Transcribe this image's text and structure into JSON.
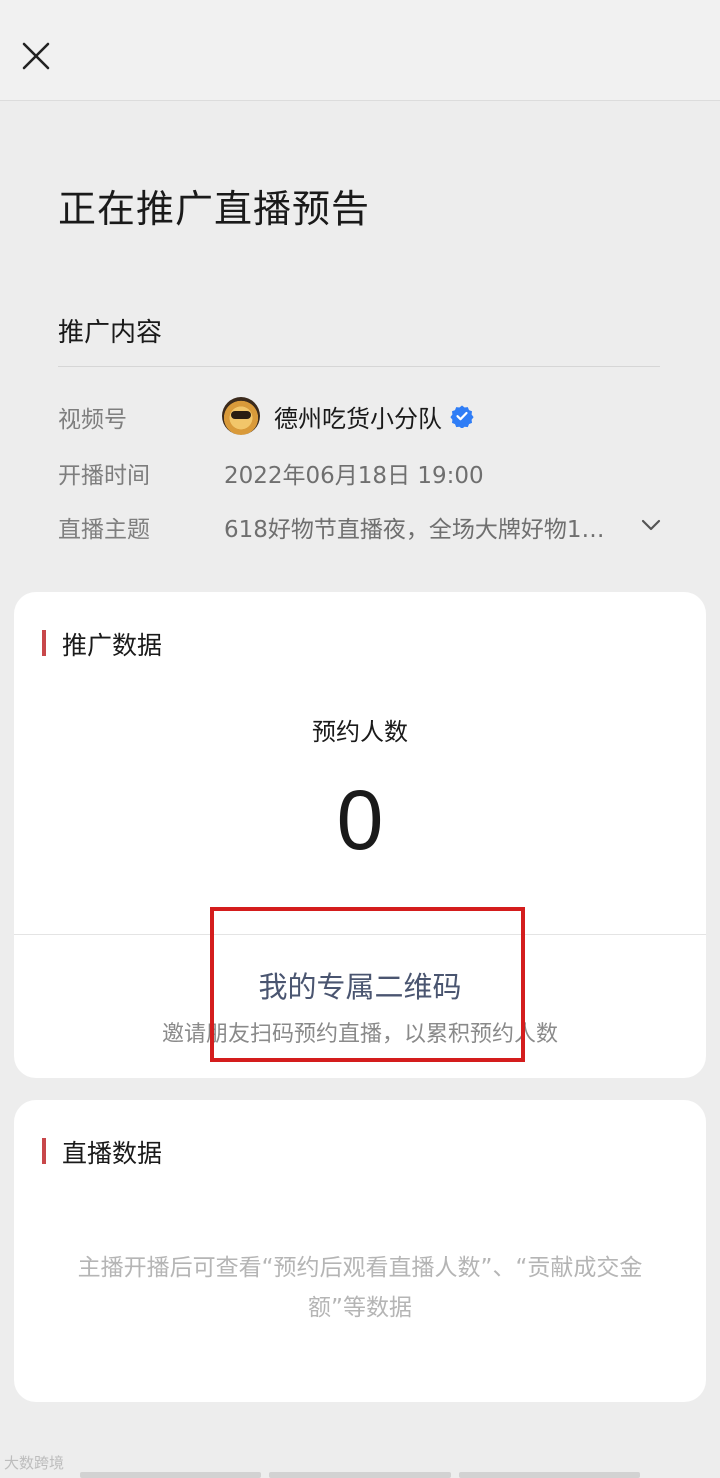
{
  "header": {
    "close_icon": "close-icon"
  },
  "page": {
    "title": "正在推广直播预告"
  },
  "promo_content": {
    "section_title": "推广内容",
    "channel_label": "视频号",
    "channel_name": "德州吃货小分队",
    "channel_verified_icon": "verified-badge-icon",
    "start_time_label": "开播时间",
    "start_time_value": "2022年06月18日 19:00",
    "topic_label": "直播主题",
    "topic_value": "618好物节直播夜，全场大牌好物1…",
    "expand_icon": "chevron-down-icon"
  },
  "promo_data": {
    "heading": "推广数据",
    "stat_label": "预约人数",
    "stat_value": "0",
    "qr_title": "我的专属二维码",
    "qr_subtitle": "邀请朋友扫码预约直播，以累积预约人数"
  },
  "live_data": {
    "heading": "直播数据",
    "note": "主播开播后可查看“预约后观看直播人数”、“贡献成交金额”等数据"
  },
  "watermark": {
    "text": "大数跨境"
  },
  "colors": {
    "accent_bar": "#c8474a",
    "highlight_border": "#d41d1d",
    "link_text": "#4a5570",
    "verified_blue": "#2f7df6"
  }
}
